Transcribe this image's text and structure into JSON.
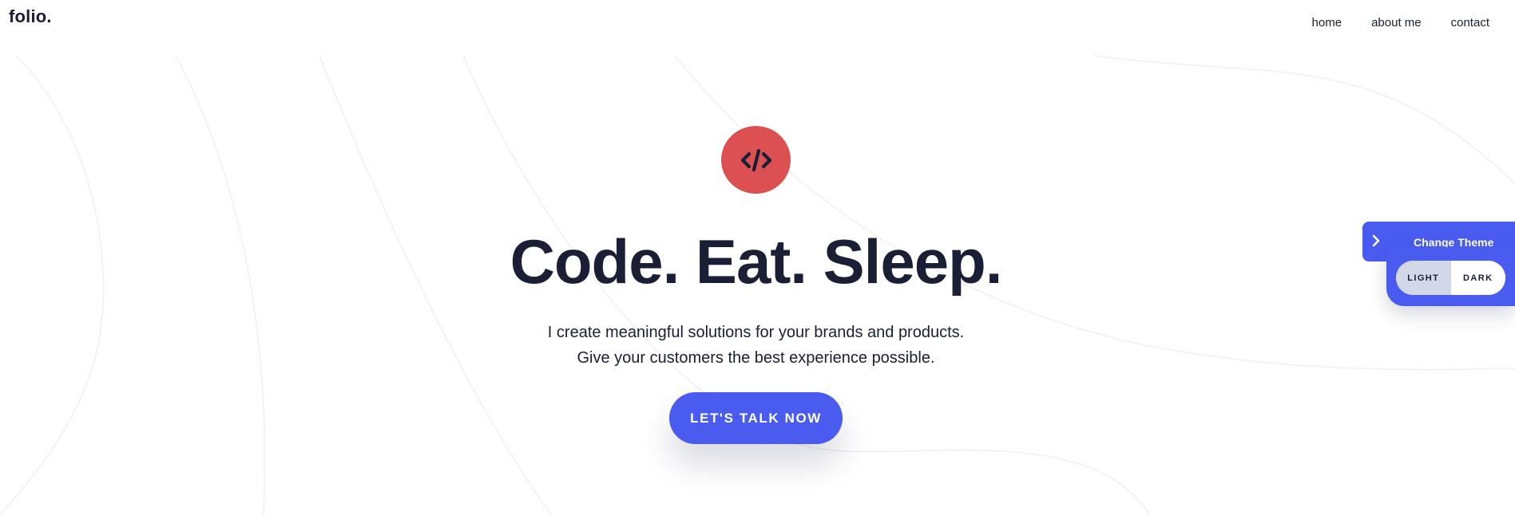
{
  "header": {
    "logo": "folio.",
    "nav": [
      {
        "label": "home"
      },
      {
        "label": "about me"
      },
      {
        "label": "contact"
      }
    ]
  },
  "hero": {
    "icon": "code-icon",
    "title": "Code. Eat. Sleep.",
    "subtitle_line1": "I create meaningful solutions for your brands and products.",
    "subtitle_line2": "Give your customers the best experience possible.",
    "cta_label": "LET'S TALK NOW"
  },
  "theme_switcher": {
    "toggle_icon": "chevron-right-icon",
    "title": "Change Theme",
    "options": [
      {
        "label": "LIGHT",
        "active": true
      },
      {
        "label": "DARK",
        "active": false
      }
    ]
  },
  "colors": {
    "accent": "#4a5cf0",
    "icon_bg": "#dc5052",
    "text": "#1a1f36",
    "active_option_bg": "#d3d8e8"
  }
}
